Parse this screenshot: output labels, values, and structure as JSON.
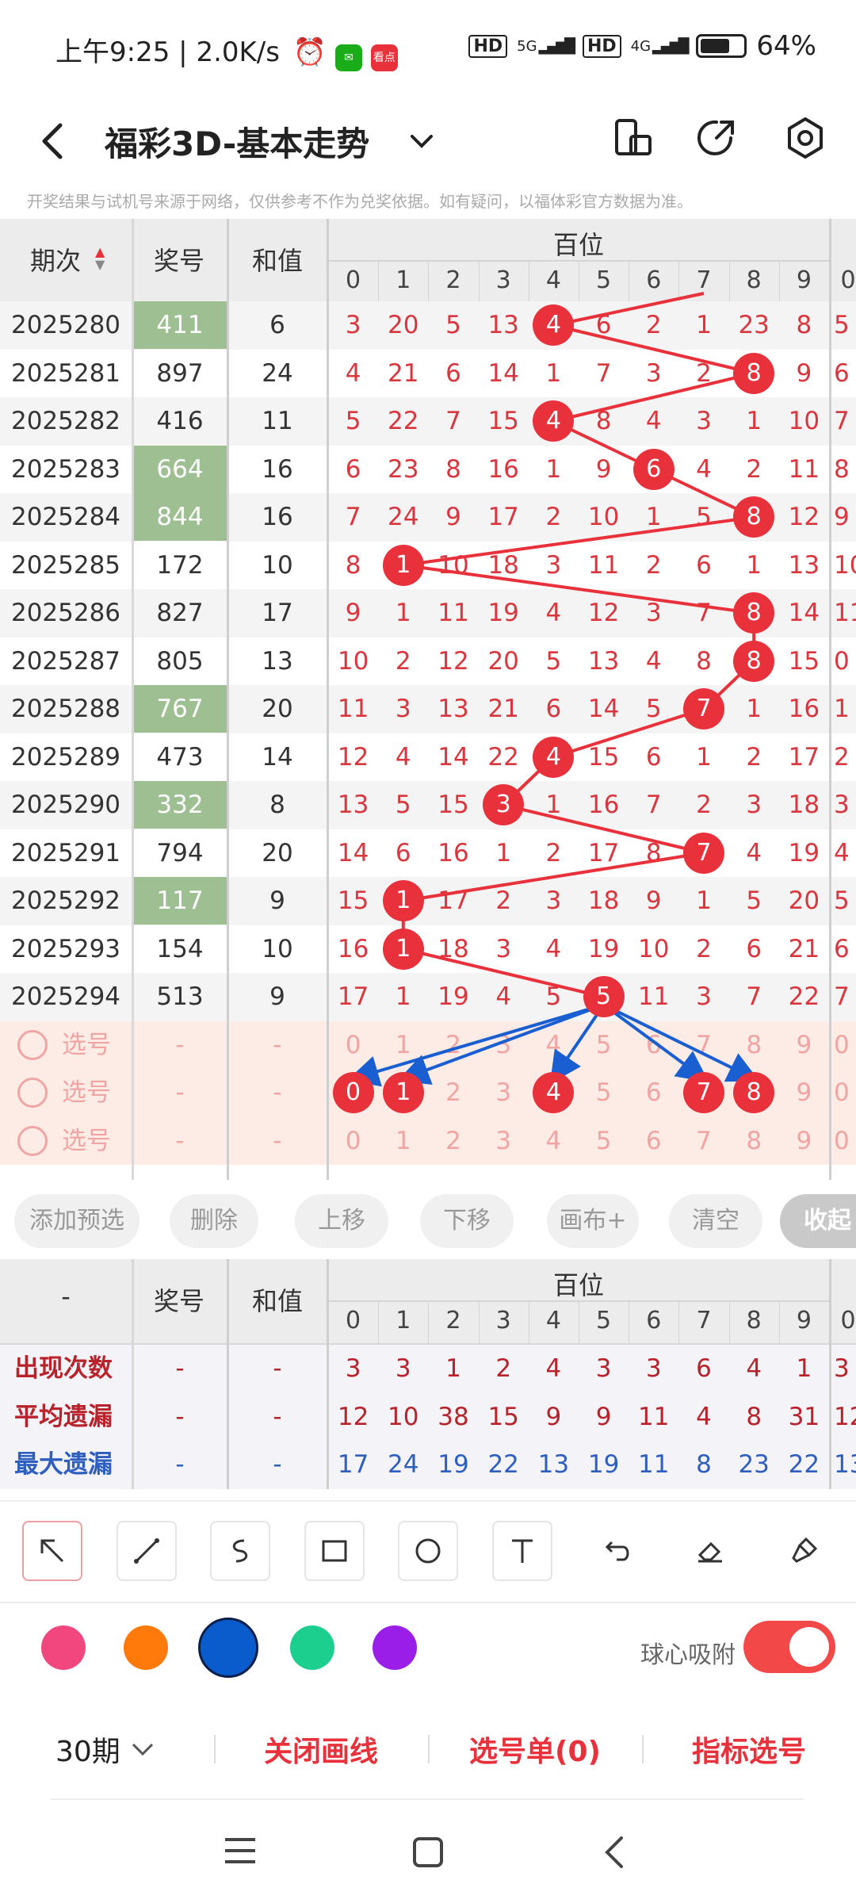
{
  "status": {
    "time": "上午9:25",
    "speed": "2.0K/s",
    "sim1": "HD",
    "net1": "5G",
    "sim2": "HD",
    "net2": "4G",
    "battery": "64%",
    "news_icon": "看点"
  },
  "header": {
    "title": "福彩3D-基本走势",
    "back_icon": "back-icon",
    "dropdown_icon": "chevron-down-icon"
  },
  "notice": "开奖结果与试机号来源于网络，仅供参考不作为兑奖依据。如有疑问，以福体彩官方数据为准。",
  "table": {
    "col_issue": "期次",
    "col_prize": "奖号",
    "col_sum": "和值",
    "group_label": "百位",
    "digits": [
      "0",
      "1",
      "2",
      "3",
      "4",
      "5",
      "6",
      "7",
      "8",
      "9"
    ],
    "next_digit": "0",
    "rows": [
      {
        "issue": "2025280",
        "prize": "411",
        "sum": "6",
        "hl": true,
        "vals": [
          "3",
          "20",
          "5",
          "13",
          "4",
          "6",
          "2",
          "1",
          "23",
          "8"
        ],
        "hit": 4,
        "next": "5"
      },
      {
        "issue": "2025281",
        "prize": "897",
        "sum": "24",
        "hl": false,
        "vals": [
          "4",
          "21",
          "6",
          "14",
          "1",
          "7",
          "3",
          "2",
          "8",
          "9"
        ],
        "hit": 8,
        "next": "6"
      },
      {
        "issue": "2025282",
        "prize": "416",
        "sum": "11",
        "hl": false,
        "vals": [
          "5",
          "22",
          "7",
          "15",
          "4",
          "8",
          "4",
          "3",
          "1",
          "10"
        ],
        "hit": 4,
        "next": "7"
      },
      {
        "issue": "2025283",
        "prize": "664",
        "sum": "16",
        "hl": true,
        "vals": [
          "6",
          "23",
          "8",
          "16",
          "1",
          "9",
          "6",
          "4",
          "2",
          "11"
        ],
        "hit": 6,
        "next": "8"
      },
      {
        "issue": "2025284",
        "prize": "844",
        "sum": "16",
        "hl": true,
        "vals": [
          "7",
          "24",
          "9",
          "17",
          "2",
          "10",
          "1",
          "5",
          "8",
          "12"
        ],
        "hit": 8,
        "next": "9"
      },
      {
        "issue": "2025285",
        "prize": "172",
        "sum": "10",
        "hl": false,
        "vals": [
          "8",
          "1",
          "10",
          "18",
          "3",
          "11",
          "2",
          "6",
          "1",
          "13"
        ],
        "hit": 1,
        "next": "10"
      },
      {
        "issue": "2025286",
        "prize": "827",
        "sum": "17",
        "hl": false,
        "vals": [
          "9",
          "1",
          "11",
          "19",
          "4",
          "12",
          "3",
          "7",
          "8",
          "14"
        ],
        "hit": 8,
        "next": "11"
      },
      {
        "issue": "2025287",
        "prize": "805",
        "sum": "13",
        "hl": false,
        "vals": [
          "10",
          "2",
          "12",
          "20",
          "5",
          "13",
          "4",
          "8",
          "8",
          "15"
        ],
        "hit": 8,
        "next": "0"
      },
      {
        "issue": "2025288",
        "prize": "767",
        "sum": "20",
        "hl": true,
        "vals": [
          "11",
          "3",
          "13",
          "21",
          "6",
          "14",
          "5",
          "7",
          "1",
          "16"
        ],
        "hit": 7,
        "next": "1"
      },
      {
        "issue": "2025289",
        "prize": "473",
        "sum": "14",
        "hl": false,
        "vals": [
          "12",
          "4",
          "14",
          "22",
          "4",
          "15",
          "6",
          "1",
          "2",
          "17"
        ],
        "hit": 4,
        "next": "2"
      },
      {
        "issue": "2025290",
        "prize": "332",
        "sum": "8",
        "hl": true,
        "vals": [
          "13",
          "5",
          "15",
          "3",
          "1",
          "16",
          "7",
          "2",
          "3",
          "18"
        ],
        "hit": 3,
        "next": "3"
      },
      {
        "issue": "2025291",
        "prize": "794",
        "sum": "20",
        "hl": false,
        "vals": [
          "14",
          "6",
          "16",
          "1",
          "2",
          "17",
          "8",
          "7",
          "4",
          "19"
        ],
        "hit": 7,
        "next": "4"
      },
      {
        "issue": "2025292",
        "prize": "117",
        "sum": "9",
        "hl": true,
        "vals": [
          "15",
          "1",
          "17",
          "2",
          "3",
          "18",
          "9",
          "1",
          "5",
          "20"
        ],
        "hit": 1,
        "next": "5"
      },
      {
        "issue": "2025293",
        "prize": "154",
        "sum": "10",
        "hl": false,
        "vals": [
          "16",
          "1",
          "18",
          "3",
          "4",
          "19",
          "10",
          "2",
          "6",
          "21"
        ],
        "hit": 1,
        "next": "6"
      },
      {
        "issue": "2025294",
        "prize": "513",
        "sum": "9",
        "hl": false,
        "vals": [
          "17",
          "1",
          "19",
          "4",
          "5",
          "5",
          "11",
          "3",
          "7",
          "22"
        ],
        "hit": 5,
        "next": "7"
      }
    ],
    "select_rows": [
      {
        "label": "选号",
        "prize": "-",
        "sum": "-",
        "balls": [],
        "next": "0"
      },
      {
        "label": "选号",
        "prize": "-",
        "sum": "-",
        "balls": [
          0,
          1,
          4,
          7,
          8
        ],
        "next": "0"
      },
      {
        "label": "选号",
        "prize": "-",
        "sum": "-",
        "balls": [],
        "next": "0"
      }
    ]
  },
  "actions": [
    "添加预选",
    "删除",
    "上移",
    "下移",
    "画布+",
    "清空",
    "收起"
  ],
  "stats": {
    "dash": "-",
    "col_prize": "奖号",
    "col_sum": "和值",
    "group_label": "百位",
    "digits": [
      "0",
      "1",
      "2",
      "3",
      "4",
      "5",
      "6",
      "7",
      "8",
      "9"
    ],
    "next_digit": "0",
    "rows": [
      {
        "label": "出现次数",
        "color": "#b8232b",
        "vals": [
          "3",
          "3",
          "1",
          "2",
          "4",
          "3",
          "3",
          "6",
          "4",
          "1"
        ],
        "next": "3"
      },
      {
        "label": "平均遗漏",
        "color": "#b8232b",
        "vals": [
          "12",
          "10",
          "38",
          "15",
          "9",
          "9",
          "11",
          "4",
          "8",
          "31"
        ],
        "next": "12"
      },
      {
        "label": "最大遗漏",
        "color": "#2e5fbf",
        "vals": [
          "17",
          "24",
          "19",
          "22",
          "13",
          "19",
          "11",
          "8",
          "23",
          "22"
        ],
        "next": "13"
      }
    ]
  },
  "tools": [
    "arrow-tool-icon",
    "line-tool-icon",
    "curve-tool-icon",
    "rect-tool-icon",
    "circle-tool-icon",
    "text-tool-icon",
    "undo-icon",
    "eraser-icon",
    "clear-brush-icon"
  ],
  "colors": [
    "#f2477e",
    "#ff7a0a",
    "#0a5ccc",
    "#1ccf8e",
    "#9b1de8"
  ],
  "selected_color": "#0a5ccc",
  "snap_label": "球心吸附",
  "snap_on": true,
  "bottom": {
    "period": "30期",
    "close_line": "关闭画线",
    "pick_list": "选号单(0)",
    "indicator": "指标选号"
  }
}
